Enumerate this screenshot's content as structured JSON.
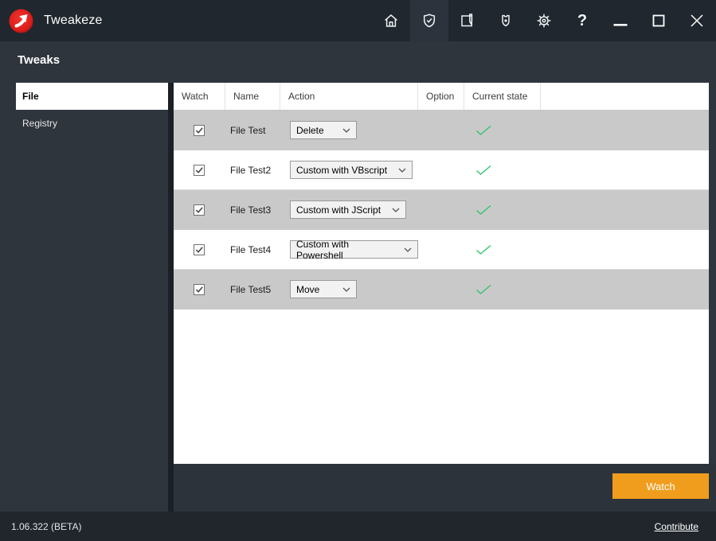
{
  "app": {
    "title": "Tweakeze",
    "version": "1.06.322 (BETA)"
  },
  "page": {
    "heading": "Tweaks"
  },
  "titlebar": {
    "nav_icons": [
      {
        "name": "home",
        "active": false
      },
      {
        "name": "shield-check",
        "active": true
      },
      {
        "name": "journal-pen",
        "active": false
      },
      {
        "name": "badge",
        "active": false
      },
      {
        "name": "settings-gear",
        "active": false
      },
      {
        "name": "help",
        "active": false,
        "glyph": "?"
      }
    ],
    "window_controls": [
      "minimize",
      "maximize",
      "close"
    ]
  },
  "sidebar": {
    "items": [
      {
        "label": "File",
        "selected": true
      },
      {
        "label": "Registry",
        "selected": false
      }
    ]
  },
  "table": {
    "columns": [
      "Watch",
      "Name",
      "Action",
      "Option",
      "Current state"
    ],
    "rows": [
      {
        "watch": true,
        "name": "File Test",
        "action": "Delete",
        "option": "",
        "state_ok": true
      },
      {
        "watch": true,
        "name": "File Test2",
        "action": "Custom with VBscript",
        "option": "",
        "state_ok": true
      },
      {
        "watch": true,
        "name": "File Test3",
        "action": "Custom with JScript",
        "option": "",
        "state_ok": true
      },
      {
        "watch": true,
        "name": "File Test4",
        "action": "Custom with Powershell",
        "option": "",
        "state_ok": true
      },
      {
        "watch": true,
        "name": "File Test5",
        "action": "Move",
        "option": "",
        "state_ok": true
      }
    ]
  },
  "actions": {
    "watch_button": "Watch"
  },
  "footer": {
    "contribute_link": "Contribute"
  },
  "colors": {
    "accent_orange": "#f09d1e",
    "ok_green": "#2fc46e",
    "logo_red": "#e22220",
    "titlebar_bg": "#20272e",
    "content_bg": "#2f353d",
    "footer_bg": "#21262d",
    "row_alt": "#c9c9c9"
  }
}
